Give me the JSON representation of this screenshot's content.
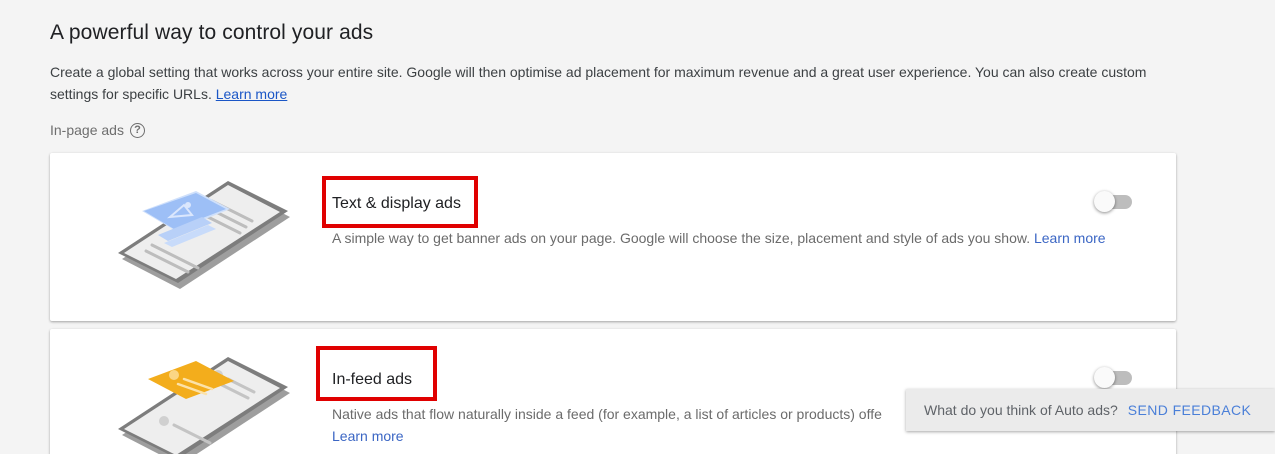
{
  "header": {
    "title": "A powerful way to control your ads",
    "intro_text": "Create a global setting that works across your entire site. Google will then optimise ad placement for maximum revenue and a great user experience. You can also create custom settings for specific URLs.",
    "learn_more": "Learn more"
  },
  "section": {
    "label": "In-page ads",
    "help_icon": "?"
  },
  "cards": [
    {
      "title": "Text & display ads",
      "description": "A simple way to get banner ads on your page. Google will choose the size, placement and style of ads you show.",
      "learn_more": "Learn more",
      "enabled": false
    },
    {
      "title": "In-feed ads",
      "description": "Native ads that flow naturally inside a feed (for example, a list of articles or products) offe",
      "learn_more": "Learn more",
      "enabled": false
    }
  ],
  "feedback": {
    "question": "What do you think of Auto ads?",
    "button": "SEND FEEDBACK"
  },
  "colors": {
    "background": "#f4f4f4",
    "link": "#1a56c6",
    "highlight_box": "#e00000",
    "feedback_button": "#4a7fd8",
    "ad_blue": "#8fb4f4",
    "ad_orange": "#f3ad1c"
  }
}
